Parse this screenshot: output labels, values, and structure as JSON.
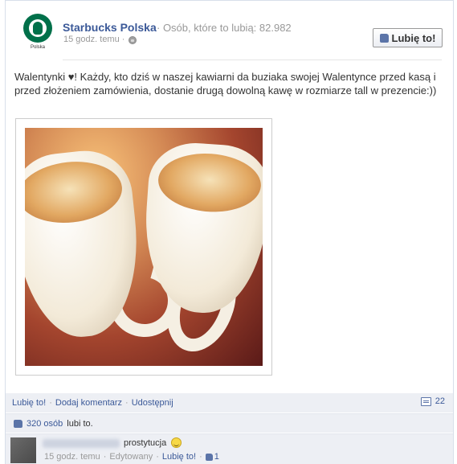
{
  "page": {
    "name": "Starbucks Polska",
    "likes_label": "· Osób, które to lubią: 82.982",
    "logo_caption": "Polska",
    "like_button_label": "Lubię to!"
  },
  "post": {
    "time": "15 godz. temu ·",
    "text": "Walentynki ♥! Każdy, kto dziś w naszej kawiarni da buziaka swojej Walentynce przed kasą i przed złożeniem zamówienia, dostanie drugą dowolną kawę w rozmiarze tall w prezencie:))"
  },
  "actions": {
    "like": "Lubię to!",
    "comment": "Dodaj komentarz",
    "share": "Udostępnij",
    "separator": "·",
    "comment_count": "22"
  },
  "likes_summary": {
    "people": "320 osób",
    "suffix": "lubi to."
  },
  "comment": {
    "text": "prostytucja",
    "time": "15 godz. temu",
    "edited": "Edytowany",
    "like_link": "Lubię to!",
    "like_count": "1",
    "separator": "·"
  },
  "icons": {
    "logo": "starbucks-logo",
    "privacy": "globe-icon",
    "like": "thumb-up-icon",
    "comments": "comment-icon",
    "emoticon": "smiley-icon"
  },
  "colors": {
    "link": "#3b5998",
    "muted": "#999999",
    "bar_bg": "#edeff4",
    "brand_green": "#00704a"
  }
}
